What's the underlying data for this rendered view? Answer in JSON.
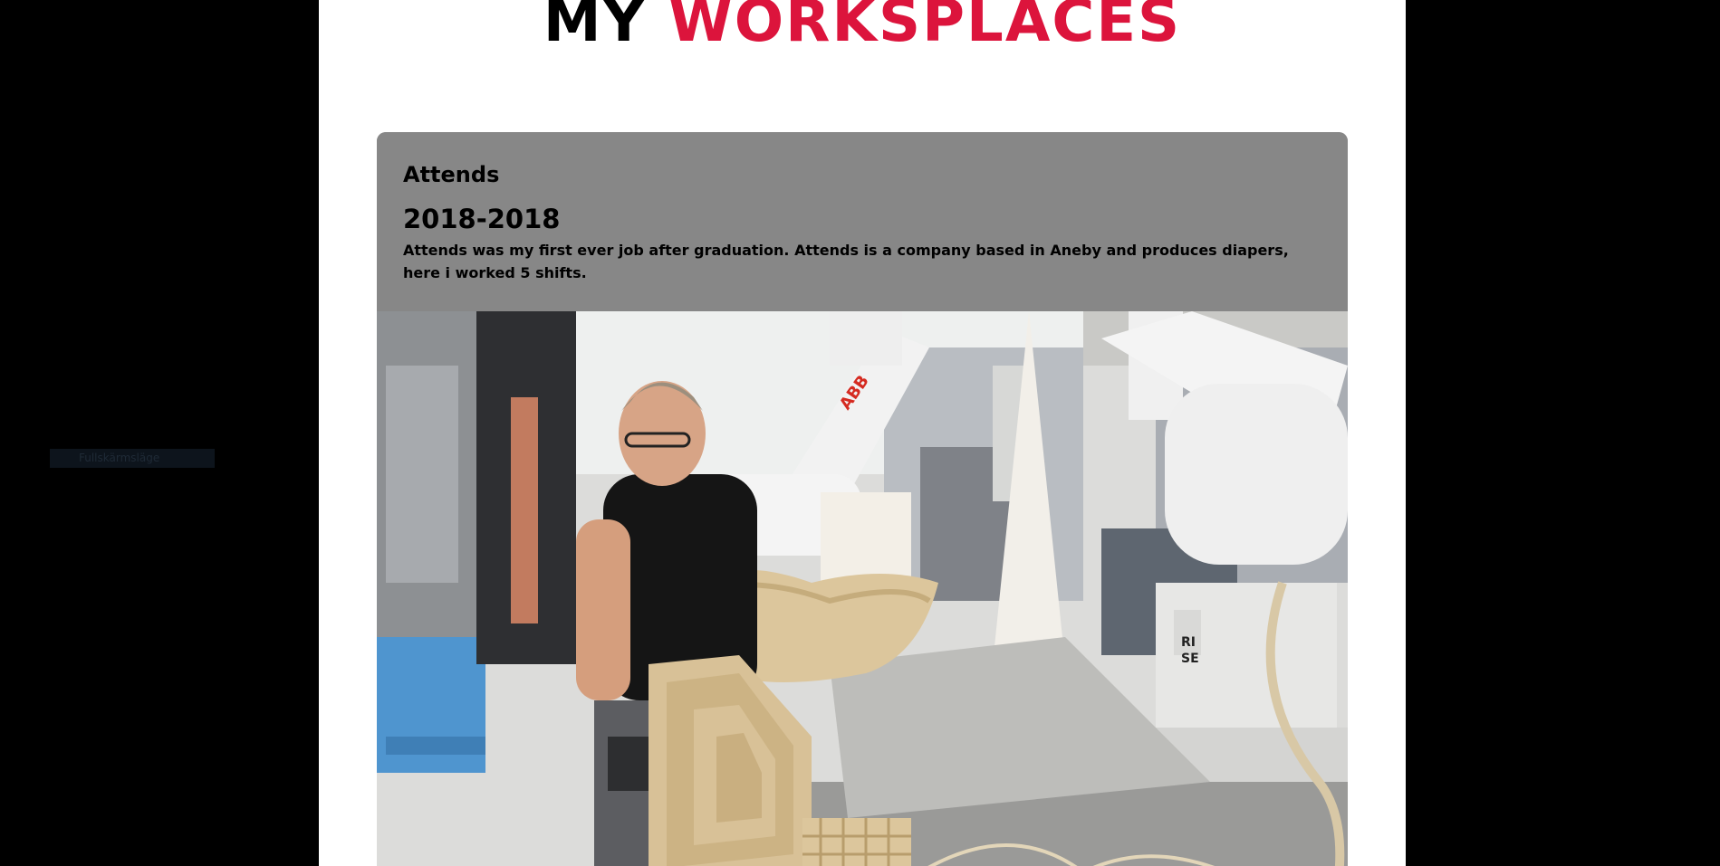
{
  "left_panel": {
    "fullscreen_button_label": "Fullskärmsläge"
  },
  "heading": {
    "word1": "MY",
    "word2": "WORKSPLACES",
    "accent_color": "#dc143c"
  },
  "workplaces": [
    {
      "company": "Attends",
      "years": "2018-2018",
      "description": "Attends was my first ever job after graduation. Attends is a company based in Aneby and produces diapers, here i worked 5 shifts.",
      "image": {
        "subject": "factory-worker-3d-printing",
        "visible_text": [
          "ABB",
          "RI SE"
        ]
      }
    }
  ]
}
